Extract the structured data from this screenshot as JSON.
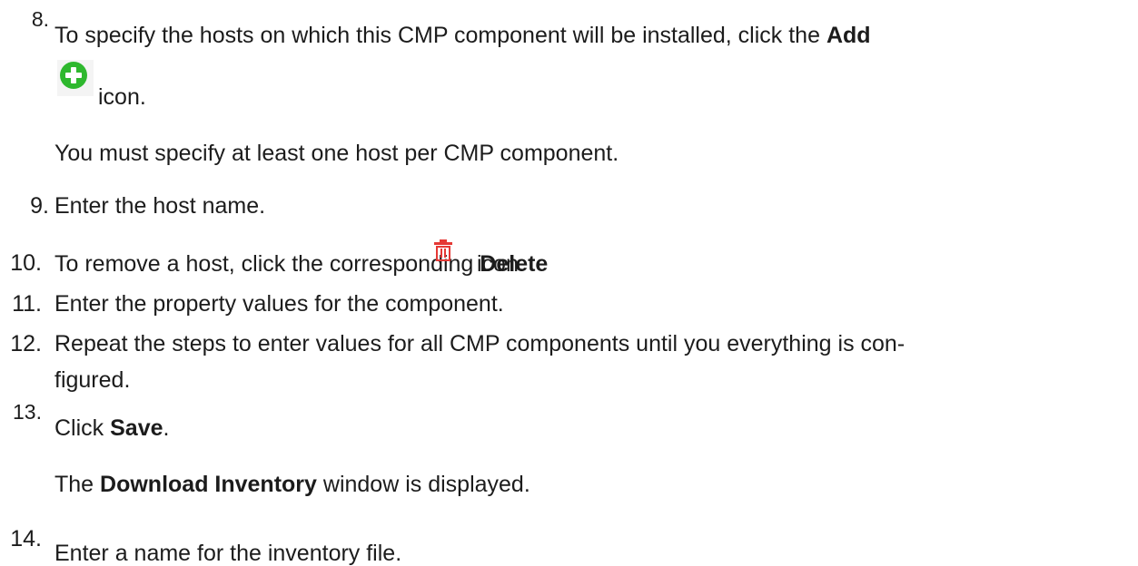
{
  "steps": [
    {
      "num": "8.",
      "pre": "To specify the hosts on which this CMP component will be installed, click the ",
      "bold": "Add"
    },
    {
      "icon_word": "icon.",
      "icon": "add-circle-icon",
      "note": "You must specify at least one host per CMP component."
    },
    {
      "num": "9.",
      "text": "Enter the host name."
    },
    {
      "num": "10.",
      "pre": "To remove a host, click the corresponding ",
      "bold": "Delete",
      "post": "icon.",
      "icon": "trash-icon"
    },
    {
      "num": "11.",
      "text": "Enter the property values for the component."
    },
    {
      "num": "12.",
      "line1": "Repeat the steps to enter values for all CMP components until you everything is con-",
      "line2": "figured."
    },
    {
      "num": "13.",
      "pre": "Click ",
      "bold": "Save",
      "post": ".",
      "note_bold": "Download Inventory",
      "note_post": " window is displayed.",
      "note_pre": "The "
    },
    {
      "num": "14.",
      "text": "Enter a name for the inventory file."
    }
  ],
  "colors": {
    "add": "#2eb82e",
    "delete": "#e53935",
    "text": "#1c1c1c"
  }
}
